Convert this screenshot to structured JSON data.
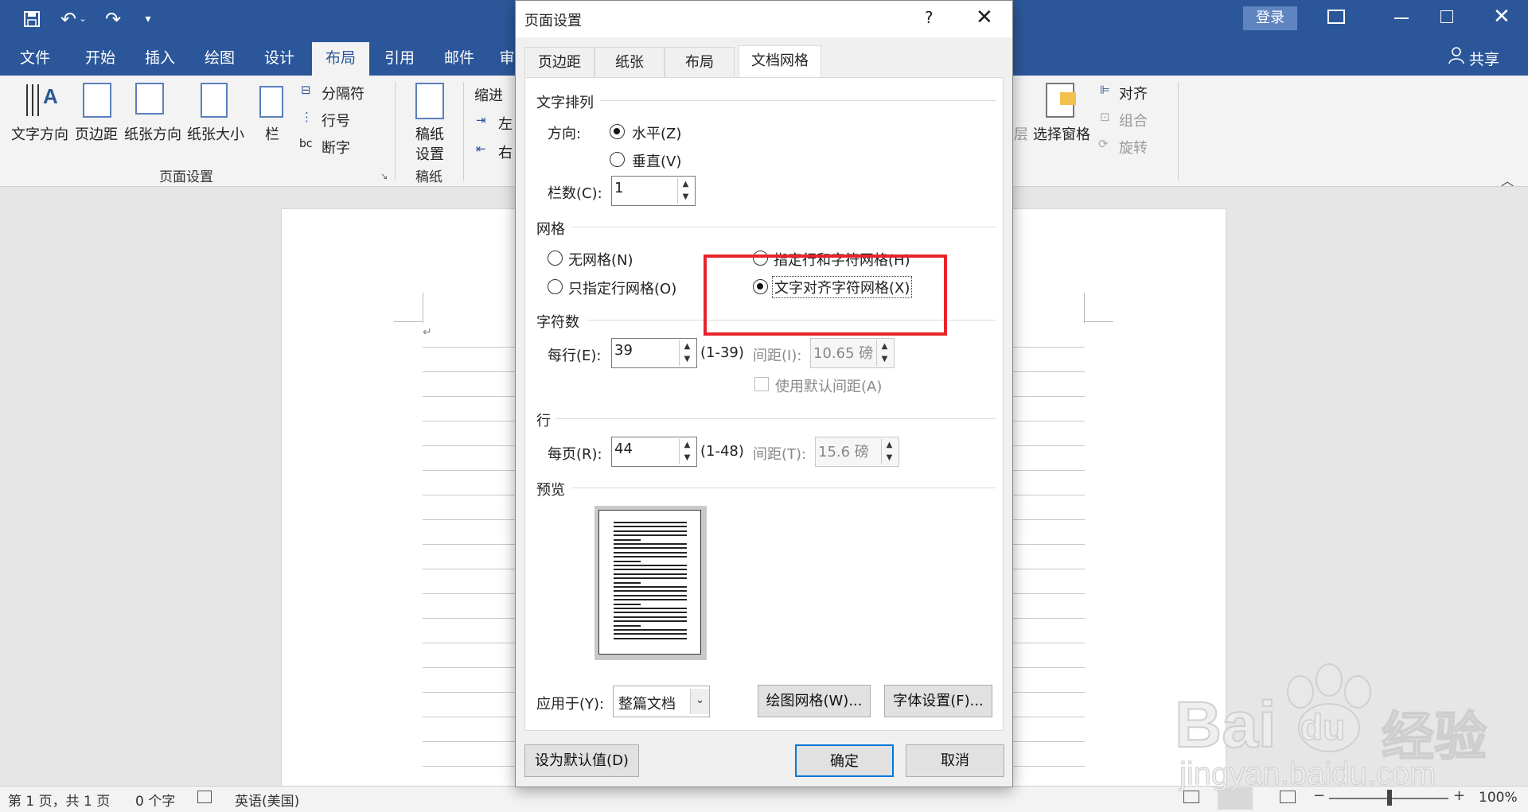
{
  "app": {
    "login_label": "登录",
    "share_label": "共享"
  },
  "ribbon_tabs": [
    "文件",
    "开始",
    "插入",
    "绘图",
    "设计",
    "布局",
    "引用",
    "邮件",
    "审"
  ],
  "ribbon": {
    "text_direction": "文字方向",
    "margins": "页边距",
    "orientation": "纸张方向",
    "size": "纸张大小",
    "columns": "栏",
    "breaks": "分隔符",
    "line_numbers": "行号",
    "hyphenation": "断字",
    "group_page_setup": "页面设置",
    "draft_setup_line1": "稿纸",
    "draft_setup_line2": "设置",
    "group_draft": "稿纸",
    "indent": "缩进",
    "indent_left": "左",
    "indent_right": "右",
    "layer": "层",
    "selection_pane": "选择窗格",
    "align": "对齐",
    "group": "组合",
    "rotate": "旋转"
  },
  "dialog": {
    "title": "页面设置",
    "help": "?",
    "tabs": [
      "页边距",
      "纸张",
      "布局",
      "文档网格"
    ],
    "text_flow": {
      "section": "文字排列",
      "direction_label": "方向:",
      "horizontal": "水平(Z)",
      "vertical": "垂直(V)",
      "columns_label": "栏数(C):",
      "columns_value": "1"
    },
    "grid": {
      "section": "网格",
      "no_grid": "无网格(N)",
      "line_grid_only": "只指定行网格(O)",
      "line_and_char_grid": "指定行和字符网格(H)",
      "snap_to_char_grid": "文字对齐字符网格(X)"
    },
    "characters": {
      "section": "字符数",
      "per_line_label": "每行(E):",
      "per_line_value": "39",
      "per_line_range": "(1-39)",
      "pitch_label": "间距(I):",
      "pitch_value": "10.65 磅",
      "use_default_pitch": "使用默认间距(A)"
    },
    "lines": {
      "section": "行",
      "per_page_label": "每页(R):",
      "per_page_value": "44",
      "per_page_range": "(1-48)",
      "pitch_label": "间距(T):",
      "pitch_value": "15.6 磅"
    },
    "preview": {
      "section": "预览"
    },
    "apply_to_label": "应用于(Y):",
    "apply_to_value": "整篇文档",
    "drawing_grid_button": "绘图网格(W)...",
    "font_settings_button": "字体设置(F)...",
    "set_default_button": "设为默认值(D)",
    "ok_button": "确定",
    "cancel_button": "取消"
  },
  "status": {
    "page": "第 1 页，共 1 页",
    "words": "0 个字",
    "language": "英语(美国)",
    "zoom": "100%"
  },
  "watermark": {
    "brand": "Bai",
    "brand_suffix": "du",
    "brand_cn": "经验",
    "url": "jingyan.baidu.com"
  },
  "colors": {
    "word_blue": "#2b579a",
    "highlight_red": "#e8242b",
    "primary_button": "#0078d7"
  }
}
